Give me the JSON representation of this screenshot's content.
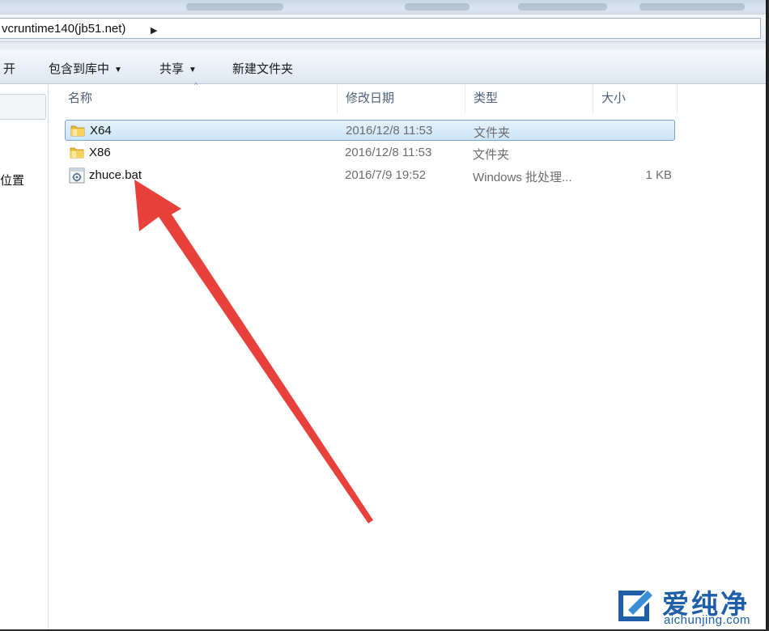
{
  "address": {
    "path_text": "vcruntime140(jb51.net)",
    "arrow_glyph": "▶"
  },
  "toolbar": {
    "items": [
      {
        "label": "开",
        "caret": ""
      },
      {
        "label": "包含到库中",
        "caret": "▼"
      },
      {
        "label": "共享",
        "caret": "▼"
      },
      {
        "label": "新建文件夹",
        "caret": ""
      }
    ]
  },
  "nav": {
    "partial_label": "位置"
  },
  "columns": {
    "name": "名称",
    "date": "修改日期",
    "type": "类型",
    "size": "大小",
    "sort_indicator": "^"
  },
  "files": [
    {
      "name": "X64",
      "date": "2016/12/8 11:53",
      "type": "文件夹",
      "size": "",
      "icon": "folder-icon",
      "selected": true
    },
    {
      "name": "X86",
      "date": "2016/12/8 11:53",
      "type": "文件夹",
      "size": "",
      "icon": "folder-icon",
      "selected": false
    },
    {
      "name": "zhuce.bat",
      "date": "2016/7/9 19:52",
      "type": "Windows 批处理...",
      "size": "1 KB",
      "icon": "batch-file-icon",
      "selected": false
    }
  ],
  "annotation": {
    "arrow_color": "#e8413c"
  },
  "watermark": {
    "cn": "爱纯净",
    "en": "aichunjing.com",
    "color": "#1f5ea8"
  }
}
